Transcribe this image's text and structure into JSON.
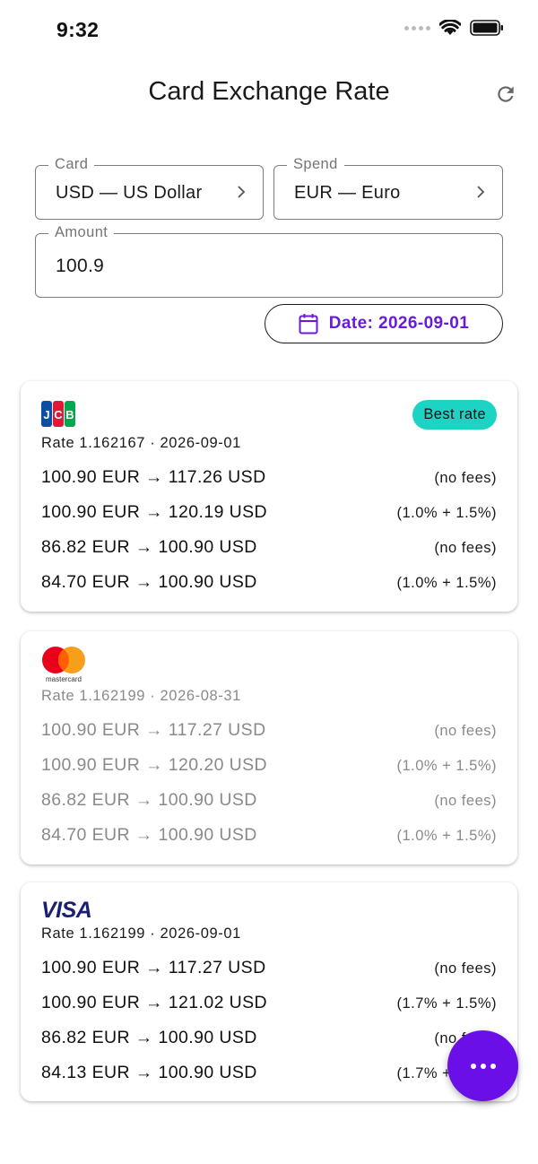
{
  "status": {
    "time": "9:32"
  },
  "app": {
    "title": "Card Exchange Rate"
  },
  "form": {
    "card": {
      "label": "Card",
      "value": "USD — US Dollar"
    },
    "spend": {
      "label": "Spend",
      "value": "EUR — Euro"
    },
    "amount": {
      "label": "Amount",
      "value": "100.9"
    },
    "date_button": "Date: 2026-09-01"
  },
  "cards": [
    {
      "network": "JCB",
      "badge": "Best rate",
      "rate": "Rate 1.162167 · 2026-09-01",
      "rows": [
        {
          "conversion": "100.90 EUR → 117.26 USD",
          "fees": "(no fees)"
        },
        {
          "conversion": "100.90 EUR → 120.19 USD",
          "fees": "(1.0% + 1.5%)"
        },
        {
          "conversion": "86.82 EUR → 100.90 USD",
          "fees": "(no fees)"
        },
        {
          "conversion": "84.70 EUR → 100.90 USD",
          "fees": "(1.0% + 1.5%)"
        }
      ]
    },
    {
      "network": "mastercard",
      "rate": "Rate 1.162199 · 2026-08-31",
      "rows": [
        {
          "conversion": "100.90 EUR → 117.27 USD",
          "fees": "(no fees)"
        },
        {
          "conversion": "100.90 EUR → 120.20 USD",
          "fees": "(1.0% + 1.5%)"
        },
        {
          "conversion": "86.82 EUR → 100.90 USD",
          "fees": "(no fees)"
        },
        {
          "conversion": "84.70 EUR → 100.90 USD",
          "fees": "(1.0% + 1.5%)"
        }
      ]
    },
    {
      "network": "VISA",
      "rate": "Rate 1.162199 · 2026-09-01",
      "rows": [
        {
          "conversion": "100.90 EUR → 117.27 USD",
          "fees": "(no fees)"
        },
        {
          "conversion": "100.90 EUR → 121.02 USD",
          "fees": "(1.7% + 1.5%)"
        },
        {
          "conversion": "86.82 EUR → 100.90 USD",
          "fees": "(no fees)"
        },
        {
          "conversion": "84.13 EUR → 100.90 USD",
          "fees": "(1.7% + 1.5%)"
        }
      ]
    }
  ],
  "colors": {
    "accent": "#6a0fe8",
    "badge": "#1dd4c4",
    "visa": "#1a1f71",
    "mc_red": "#eb001b",
    "mc_orange": "#f79e1b"
  },
  "icons": [
    "signal-icon",
    "wifi-icon",
    "battery-icon",
    "refresh-icon",
    "chevron-right-icon",
    "calendar-icon",
    "more-icon"
  ]
}
